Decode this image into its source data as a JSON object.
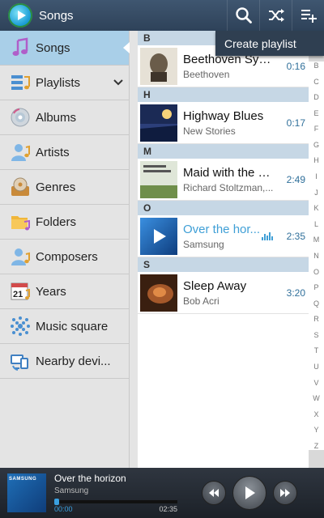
{
  "actionbar": {
    "title": "Songs",
    "search_icon": "search-icon",
    "shuffle_icon": "shuffle-icon",
    "add_playlist_icon": "playlist-add-icon"
  },
  "popup": {
    "label": "Create playlist"
  },
  "drawer": {
    "items": [
      {
        "label": "Songs",
        "icon": "music-note-icon"
      },
      {
        "label": "Playlists",
        "icon": "playlists-icon"
      },
      {
        "label": "Albums",
        "icon": "album-disc-icon"
      },
      {
        "label": "Artists",
        "icon": "artist-icon"
      },
      {
        "label": "Genres",
        "icon": "genres-icon"
      },
      {
        "label": "Folders",
        "icon": "folder-icon"
      },
      {
        "label": "Composers",
        "icon": "composer-icon"
      },
      {
        "label": "Years",
        "icon": "calendar-icon"
      },
      {
        "label": "Music square",
        "icon": "music-square-icon"
      },
      {
        "label": "Nearby devi...",
        "icon": "nearby-devices-icon"
      }
    ]
  },
  "list": {
    "sections": [
      {
        "letter": "B",
        "song": {
          "title": "Beethoven Symp...",
          "artist": "Beethoven",
          "duration": "0:16"
        }
      },
      {
        "letter": "H",
        "song": {
          "title": "Highway Blues",
          "artist": "New Stories",
          "duration": "0:17"
        }
      },
      {
        "letter": "M",
        "song": {
          "title": "Maid with the Fla...",
          "artist": "Richard Stoltzman,...",
          "duration": "2:49"
        }
      },
      {
        "letter": "O",
        "song": {
          "title": "Over the hor...",
          "artist": "Samsung",
          "duration": "2:35"
        }
      },
      {
        "letter": "S",
        "song": {
          "title": "Sleep Away",
          "artist": "Bob Acri",
          "duration": "3:20"
        }
      }
    ]
  },
  "index": [
    "B",
    "C",
    "D",
    "E",
    "F",
    "G",
    "H",
    "I",
    "J",
    "K",
    "L",
    "M",
    "N",
    "O",
    "P",
    "Q",
    "R",
    "S",
    "T",
    "U",
    "V",
    "W",
    "X",
    "Y",
    "Z"
  ],
  "player": {
    "title": "Over the horizon",
    "artist": "Samsung",
    "current_time": "00:00",
    "total_time": "02:35",
    "progress": 0.02,
    "thumb_brand": "SAMSUNG"
  },
  "colors": {
    "accent": "#3f9fd6",
    "actionbar": "#3f5670",
    "section_header": "#c6d7e5",
    "drawer_active": "#a9cfe8"
  }
}
